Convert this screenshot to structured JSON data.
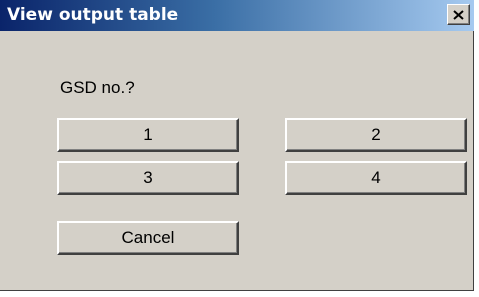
{
  "window": {
    "title": "View output table",
    "close_icon": "close-icon"
  },
  "prompt": "GSD no.?",
  "options": [
    "1",
    "2",
    "3",
    "4"
  ],
  "cancel_label": "Cancel"
}
